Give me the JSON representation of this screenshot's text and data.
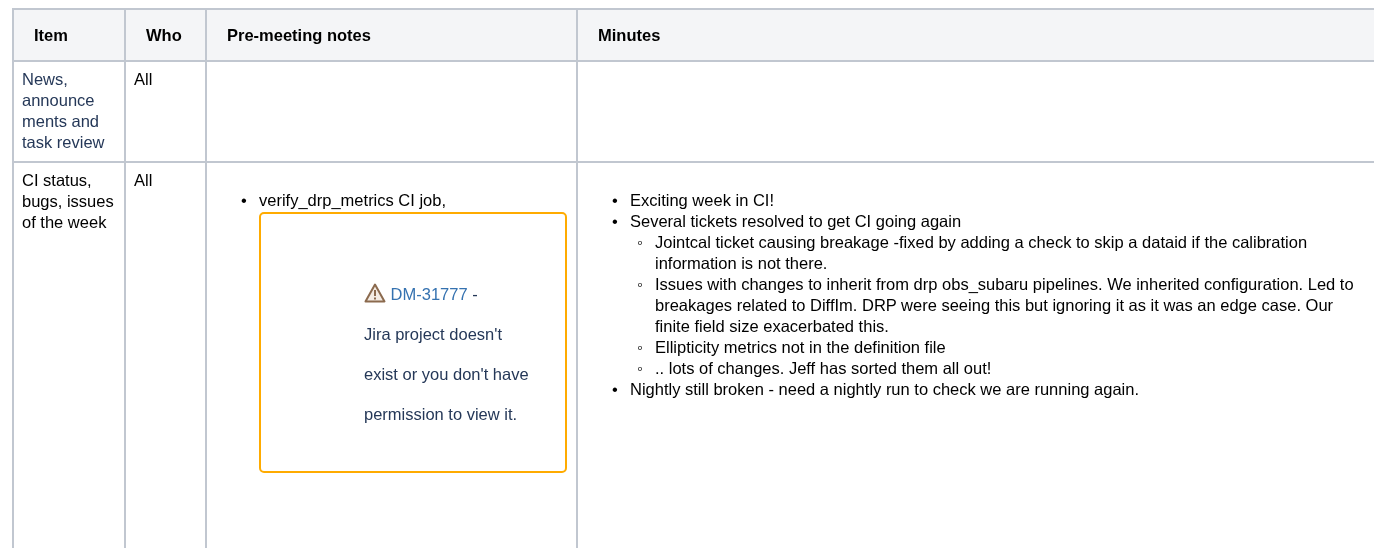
{
  "table": {
    "columns": [
      "Item",
      "Who",
      "Pre-meeting notes",
      "Minutes"
    ],
    "rows": [
      {
        "item": {
          "text": "News, announce ments and task review",
          "kind": "link"
        },
        "who": "All",
        "notes": [],
        "minutes": []
      },
      {
        "item": {
          "text": "CI status, bugs, issues of the week",
          "kind": "text"
        },
        "who": "All",
        "notes": [
          {
            "marker": "•",
            "text": "verify_drp_metrics CI job,",
            "jira_error": {
              "issue": "DM-31777",
              "separator": "-",
              "message": "Jira project doesn't exist or you don't have permission to view it."
            }
          }
        ],
        "minutes": [
          {
            "marker": "•",
            "text": "Exciting week in CI!"
          },
          {
            "marker": "•",
            "text": "Several tickets resolved to get CI going again",
            "children": [
              {
                "marker": "◦",
                "text": "Jointcal ticket causing breakage  -fixed by adding a check to skip a dataid if the calibration information is not there."
              },
              {
                "marker": "◦",
                "text": "Issues with changes to inherit from drp obs_subaru pipelines. We inherited configuration.  Led to breakages related to DiffIm. DRP were seeing this but ignoring it as it was an edge case. Our finite field size exacerbated this."
              },
              {
                "marker": "◦",
                "text": "Ellipticity metrics not in the definition file"
              },
              {
                "marker": "◦",
                "text": ".. lots of changes. Jeff has sorted them all out!"
              }
            ]
          },
          {
            "marker": "•",
            "text": "Nightly still broken - need a nightly run to check we are running again."
          }
        ]
      }
    ]
  }
}
